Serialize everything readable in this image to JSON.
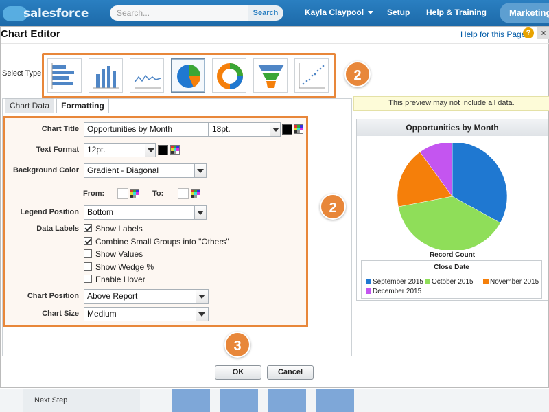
{
  "header": {
    "logo_text": "salesforce",
    "search_placeholder": "Search...",
    "search_button": "Search",
    "user_name": "Kayla Claypool",
    "setup": "Setup",
    "help_training": "Help & Training",
    "app_name": "Marketing"
  },
  "dialog": {
    "title": "Chart Editor",
    "help_link": "Help for this Page",
    "help_icon": "?",
    "close_icon": "×",
    "select_type_label": "Select Type",
    "chart_types": [
      "horizontal-bar",
      "vertical-bar",
      "line",
      "pie",
      "donut",
      "funnel",
      "scatter"
    ],
    "selected_type": "pie",
    "tabs": [
      "Chart Data",
      "Formatting"
    ],
    "active_tab": "Formatting"
  },
  "callouts": {
    "type_step": "2",
    "format_step": "2",
    "ok_step": "3",
    "color": "#e8873a"
  },
  "formatting": {
    "chart_title_label": "Chart Title",
    "chart_title_value": "Opportunities by Month",
    "chart_title_size": "18pt.",
    "text_format_label": "Text Format",
    "text_format_value": "12pt.",
    "background_color_label": "Background Color",
    "background_color_value": "Gradient - Diagonal",
    "from_label": "From:",
    "to_label": "To:",
    "legend_position_label": "Legend Position",
    "legend_position_value": "Bottom",
    "data_labels_label": "Data Labels",
    "options": [
      {
        "label": "Show Labels",
        "checked": true
      },
      {
        "label": "Combine Small Groups into \"Others\"",
        "checked": true
      },
      {
        "label": "Show Values",
        "checked": false
      },
      {
        "label": "Show Wedge %",
        "checked": false
      },
      {
        "label": "Enable Hover",
        "checked": false
      }
    ],
    "chart_position_label": "Chart Position",
    "chart_position_value": "Above Report",
    "chart_size_label": "Chart Size",
    "chart_size_value": "Medium"
  },
  "preview": {
    "note": "This preview may not include all data.",
    "title": "Opportunities by Month",
    "measure_label": "Record Count",
    "legend_title": "Close Date"
  },
  "chart_data": {
    "type": "pie",
    "title": "Opportunities by Month",
    "categories": [
      "September 2015",
      "October 2015",
      "November 2015",
      "December 2015"
    ],
    "values": [
      33,
      39,
      18,
      10
    ],
    "colors": [
      "#1f78d1",
      "#8fde59",
      "#f57f0a",
      "#c455f0"
    ],
    "legend": "bottom",
    "legend_title": "Close Date"
  },
  "buttons": {
    "ok": "OK",
    "cancel": "Cancel"
  },
  "background": {
    "next_step": "Next Step"
  }
}
